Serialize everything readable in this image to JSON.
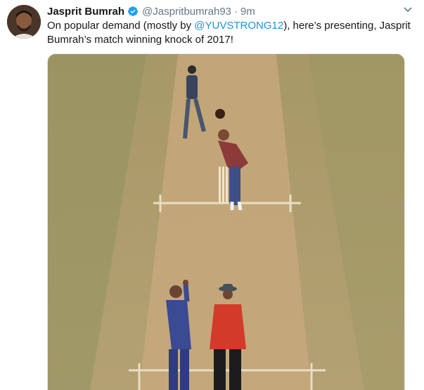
{
  "tweet": {
    "author_name": "Jasprit Bumrah",
    "handle": "@Jaspritbumrah93",
    "separator": "·",
    "time": "9m",
    "text_before": "On popular demand (mostly by ",
    "mention": "@YUVSTRONG12",
    "text_after": "), here’s presenting, Jasprit Bumrah’s match winning knock of 2017!"
  },
  "icons": {
    "verified": "verified-badge-icon",
    "caret": "chevron-down-icon"
  },
  "colors": {
    "name": "#14171a",
    "secondary": "#657786",
    "link": "#1b95e0",
    "verified": "#1da1f2"
  }
}
